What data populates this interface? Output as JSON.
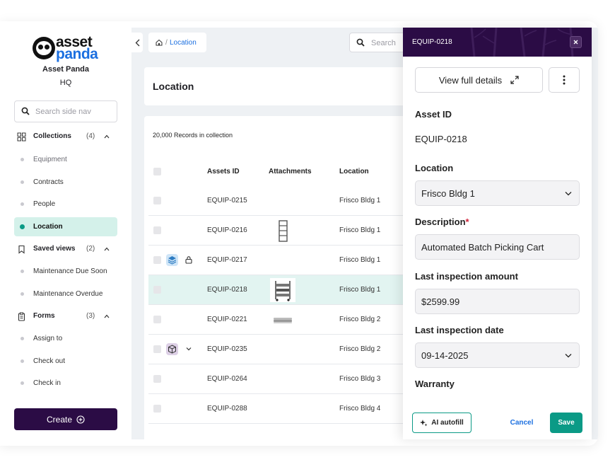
{
  "brand": {
    "logo_top": "asset",
    "logo_bottom": "panda",
    "org_name": "Asset Panda",
    "org_sub": "HQ"
  },
  "sidebar": {
    "search_placeholder": "Search side nav",
    "groups": [
      {
        "label": "Collections",
        "count": "(4)",
        "items": [
          "Equipment",
          "Contracts",
          "People",
          "Location"
        ]
      },
      {
        "label": "Saved views",
        "count": "(2)",
        "items": [
          "Maintenance Due Soon",
          "Maintenance Overdue"
        ]
      },
      {
        "label": "Forms",
        "count": "(3)",
        "items": [
          "Assign to",
          "Check out",
          "Check in"
        ]
      }
    ],
    "active_item": "Location",
    "create_label": "Create"
  },
  "topbar": {
    "breadcrumb_current": "Location",
    "breadcrumb_sep": "/",
    "search_placeholder": "Search"
  },
  "main": {
    "title": "Location",
    "record_count": "20,000 Records in collection",
    "columns": [
      "Assets ID",
      "Attachments",
      "Location"
    ],
    "rows": [
      {
        "id": "EQUIP-0215",
        "location": "Frisco Bldg 1"
      },
      {
        "id": "EQUIP-0216",
        "location": "Frisco Bldg 1"
      },
      {
        "id": "EQUIP-0217",
        "location": "Frisco Bldg 1"
      },
      {
        "id": "EQUIP-0218",
        "location": "Frisco Bldg 1"
      },
      {
        "id": "EQUIP-0221",
        "location": "Frisco Bldg 2"
      },
      {
        "id": "EQUIP-0235",
        "location": "Frisco Bldg 2"
      },
      {
        "id": "EQUIP-0264",
        "location": "Frisco Bldg 3"
      },
      {
        "id": "EQUIP-0288",
        "location": "Frisco Bldg 4"
      }
    ]
  },
  "drawer": {
    "title": "EQUIP-0218",
    "view_details_label": "View full details",
    "asset_id_label": "Asset ID",
    "asset_id_value": "EQUIP-0218",
    "location_label": "Location",
    "location_value": "Frisco Bldg 1",
    "description_label": "Description",
    "required_mark": "*",
    "description_value": "Automated Batch Picking Cart",
    "inspection_amount_label": "Last inspection amount",
    "inspection_amount_value": "$2599.99",
    "inspection_date_label": "Last inspection date",
    "inspection_date_value": "09-14-2025",
    "warranty_label": "Warranty",
    "ai_autofill_label": "AI autofill",
    "cancel_label": "Cancel",
    "save_label": "Save"
  },
  "colors": {
    "brand_purple": "#2b0c45",
    "accent_teal": "#0b9a86",
    "link_blue": "#1b6fe0",
    "selected_row": "#e2f4f1"
  }
}
